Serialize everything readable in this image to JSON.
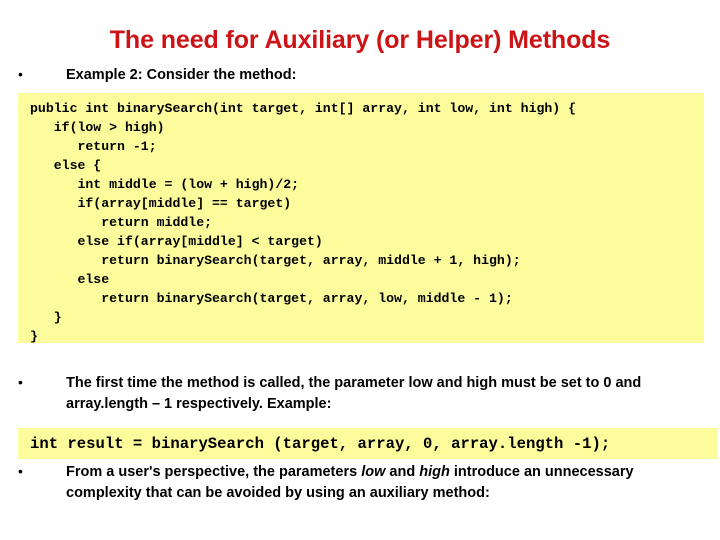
{
  "slide": {
    "title": "The need for Auxiliary (or Helper) Methods",
    "title_color": "#cc1416",
    "code_background": "#fcfc9c",
    "background": "#ffffff",
    "bullet_glyph": "•"
  },
  "bullets": {
    "first": "Example 2: Consider the method:",
    "second": "The first time the method is called, the parameter low and high must be set to 0 and array.length – 1 respectively. Example:",
    "third_part1": "From a user's perspective, the parameters ",
    "third_italic1": "low",
    "third_part2": " and ",
    "third_italic2": "high",
    "third_part3": " introduce an unnecessary complexity that can be avoided by using an auxiliary method:"
  },
  "code": {
    "primary": "public int binarySearch(int target, int[] array, int low, int high) {\n   if(low > high)\n      return -1;\n   else {\n      int middle = (low + high)/2;\n      if(array[middle] == target)\n         return middle;\n      else if(array[middle] < target)\n         return binarySearch(target, array, middle + 1, high);\n      else\n         return binarySearch(target, array, low, middle - 1);\n   }\n}",
    "secondary": "int result = binarySearch (target, array, 0, array.length -1);"
  }
}
